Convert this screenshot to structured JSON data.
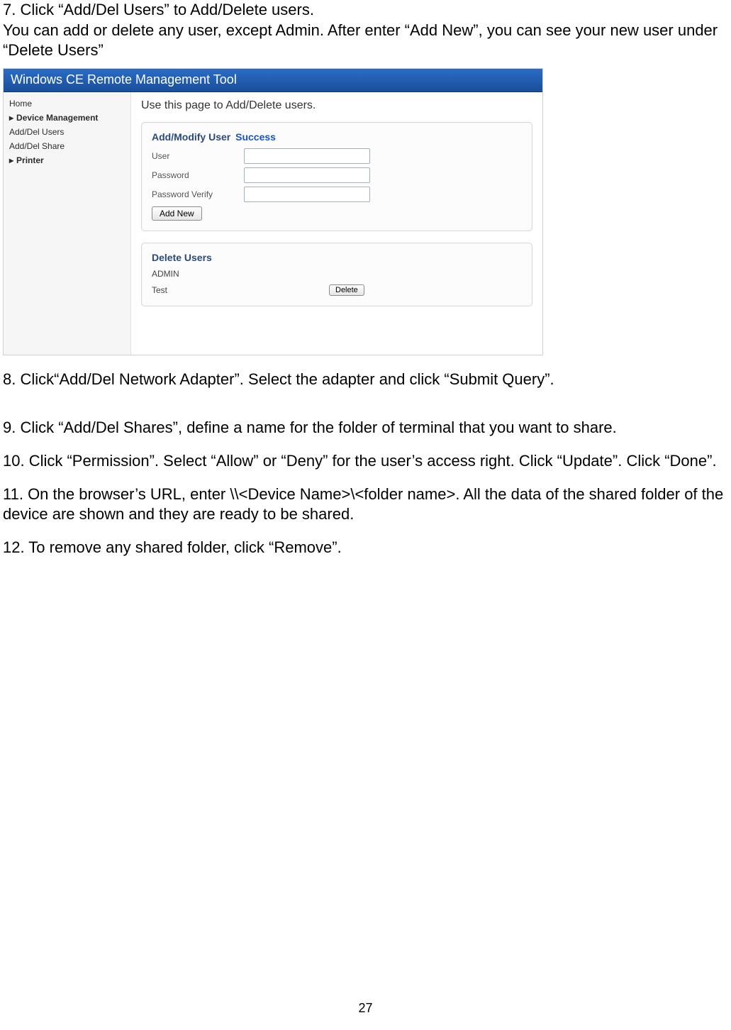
{
  "doc": {
    "step7_line1": "7. Click “Add/Del Users” to Add/Delete users.",
    "step7_line2": "  You can add or delete any user, except Admin. After enter “Add New”, you can see your new user under “Delete Users”",
    "step8": "8. Click“Add/Del Network Adapter”. Select the adapter and click “Submit Query”.",
    "step9": "9. Click “Add/Del Shares”, define a name for the folder of terminal that you want to share.",
    "step10": "10. Click “Permission”. Select “Allow” or “Deny” for the user’s access right. Click “Update”. Click “Done”.",
    "step11": "11. On the browser’s URL, enter \\\\<Device Name>\\<folder name>. All the data of the shared folder of the device are shown and they are ready to be shared.",
    "step12": "12. To remove any shared folder, click “Remove”.",
    "page_number": "27"
  },
  "screenshot": {
    "titlebar": "Windows CE Remote Management Tool",
    "sidebar": {
      "items": [
        {
          "label": "Home",
          "bold": false,
          "marker": ""
        },
        {
          "label": "Device Management",
          "bold": true,
          "marker": "▸"
        },
        {
          "label": "Add/Del Users",
          "bold": false,
          "marker": ""
        },
        {
          "label": "Add/Del Share",
          "bold": false,
          "marker": ""
        },
        {
          "label": "Printer",
          "bold": true,
          "marker": "▸"
        }
      ]
    },
    "main": {
      "heading": "Use this page to Add/Delete users.",
      "add_panel": {
        "title": "Add/Modify User",
        "status": "Success",
        "user_label": "User",
        "password_label": "Password",
        "verify_label": "Password Verify",
        "button": "Add New"
      },
      "delete_panel": {
        "title": "Delete Users",
        "users": [
          "ADMIN",
          "Test"
        ],
        "button": "Delete"
      }
    }
  }
}
